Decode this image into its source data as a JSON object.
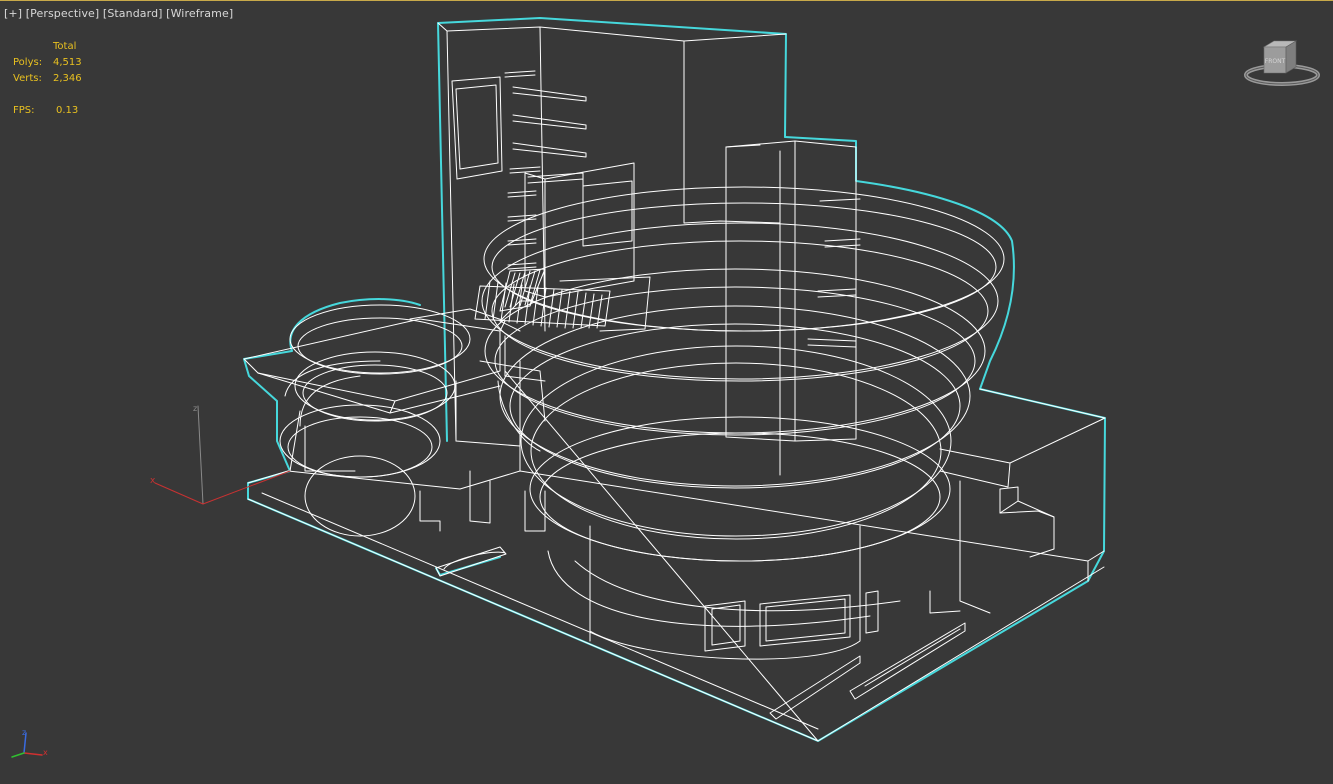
{
  "viewport": {
    "labels": {
      "plus": "[+]",
      "view": "[Perspective]",
      "shading": "[Standard]",
      "mode": "[Wireframe]"
    },
    "stats": {
      "header": "Total",
      "polys_label": "Polys:",
      "polys_value": "4,513",
      "verts_label": "Verts:",
      "verts_value": "2,346",
      "fps_label": "FPS:",
      "fps_value": "0.13"
    },
    "gizmo": {
      "z_label": "z",
      "x_label": "x"
    },
    "corner_axis": {
      "z_label": "z",
      "x_label": "x"
    },
    "viewcube": {
      "face_label": "FRONT"
    }
  },
  "colors": {
    "background": "#383838",
    "wire": "#ffffff",
    "selection": "#46d8dc",
    "stats_text": "#e8c020",
    "label_text": "#d8d8d8"
  }
}
